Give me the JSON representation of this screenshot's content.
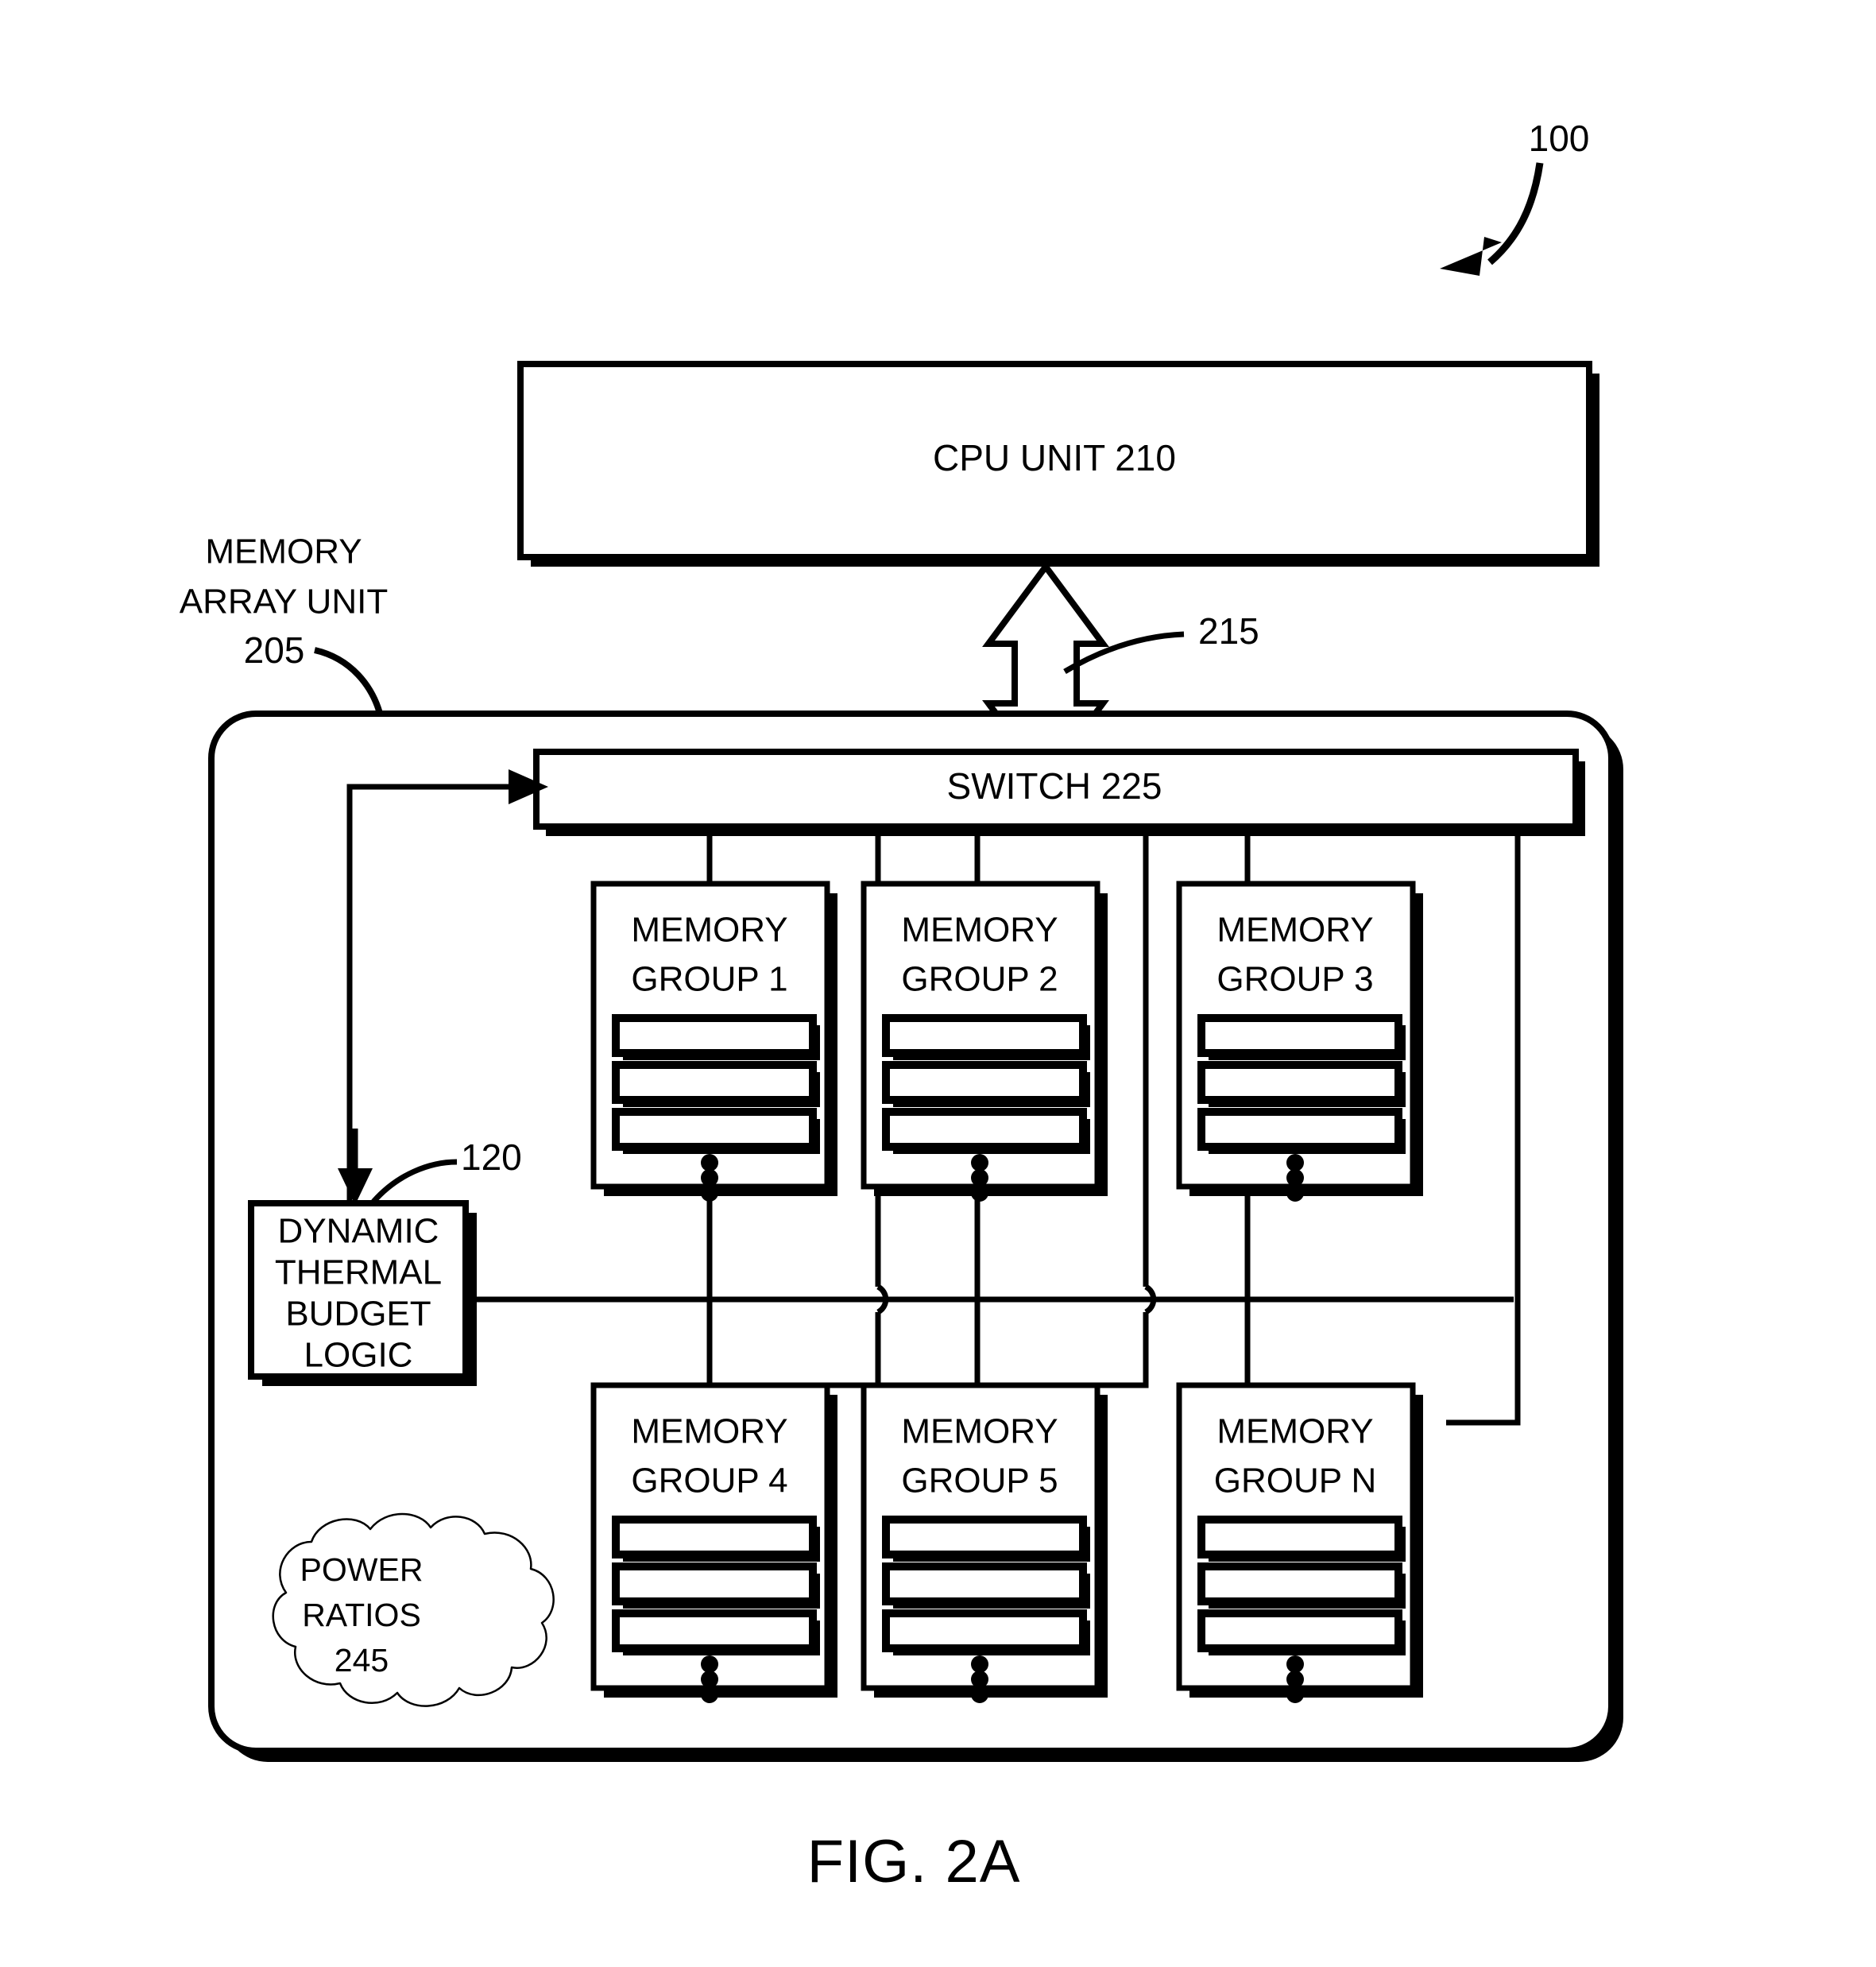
{
  "figure": {
    "caption": "FIG. 2A",
    "system_ref": "100"
  },
  "labels": {
    "memory_array_unit_line1": "MEMORY",
    "memory_array_unit_line2": "ARRAY UNIT",
    "memory_array_unit_ref": "205",
    "bus_ref": "215",
    "dtbl_ref": "120"
  },
  "cpu": {
    "title": "CPU UNIT 210"
  },
  "switch": {
    "title": "SWITCH 225"
  },
  "dtbl": {
    "line1": "DYNAMIC",
    "line2": "THERMAL",
    "line3": "BUDGET",
    "line4": "LOGIC"
  },
  "cloud": {
    "line1": "POWER",
    "line2": "RATIOS",
    "line3": "245"
  },
  "memory_groups": [
    {
      "line1": "MEMORY",
      "line2": "GROUP 1"
    },
    {
      "line1": "MEMORY",
      "line2": "GROUP 2"
    },
    {
      "line1": "MEMORY",
      "line2": "GROUP 3"
    },
    {
      "line1": "MEMORY",
      "line2": "GROUP 4"
    },
    {
      "line1": "MEMORY",
      "line2": "GROUP 5"
    },
    {
      "line1": "MEMORY",
      "line2": "GROUP N"
    }
  ],
  "colors": {
    "ink": "#000000",
    "paper": "#ffffff"
  }
}
